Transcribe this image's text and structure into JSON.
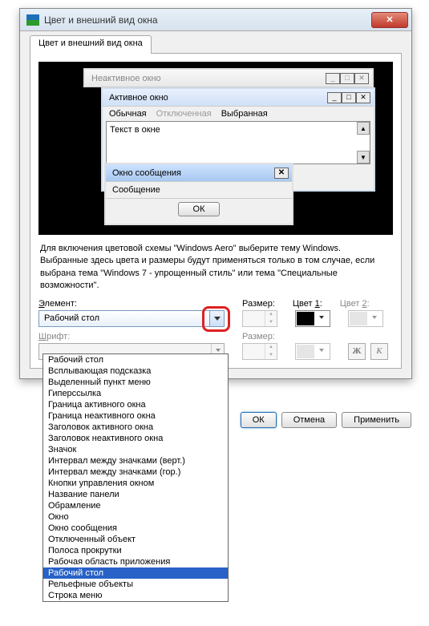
{
  "titlebar": {
    "text": "Цвет и внешний вид окна"
  },
  "tab": {
    "label": "Цвет и внешний вид окна"
  },
  "preview": {
    "inactive_title": "Неактивное окно",
    "active_title": "Активное окно",
    "menu_normal": "Обычная",
    "menu_disabled": "Отключенная",
    "menu_selected": "Выбранная",
    "textbox_text": "Текст в окне",
    "msg_title": "Окно сообщения",
    "msg_text": "Сообщение",
    "ok": "ОК"
  },
  "info": "Для включения цветовой схемы \"Windows Aero\" выберите тему Windows. Выбранные здесь цвета и размеры будут применяться только в том случае, если выбрана тема \"Windows 7 - упрощенный стиль\" или тема \"Специальные возможности\".",
  "labels": {
    "element": "Элемент:",
    "size": "Размер:",
    "color1_pre": "Цвет ",
    "color1_u": "1",
    "color1_post": ":",
    "color2_pre": "Цвет ",
    "color2_u": "2",
    "color2_post": ":",
    "font": "Шрифт:"
  },
  "combo_value": "Рабочий стол",
  "style": {
    "b": "Ж",
    "i": "К"
  },
  "dialog_buttons": {
    "ok": "ОК",
    "cancel": "Отмена",
    "apply": "Применить"
  },
  "dropdown": {
    "items": [
      "Рабочий стол",
      "Всплывающая подсказка",
      "Выделенный пункт меню",
      "Гиперссылка",
      "Граница активного окна",
      "Граница неактивного окна",
      "Заголовок активного окна",
      "Заголовок неактивного окна",
      "Значок",
      "Интервал между значками (верт.)",
      "Интервал между значками (гор.)",
      "Кнопки управления окном",
      "Название панели",
      "Обрамление",
      "Окно",
      "Окно сообщения",
      "Отключенный объект",
      "Полоса прокрутки",
      "Рабочая область приложения",
      "Рабочий стол",
      "Рельефные объекты",
      "Строка меню"
    ],
    "selected_index": 19
  }
}
